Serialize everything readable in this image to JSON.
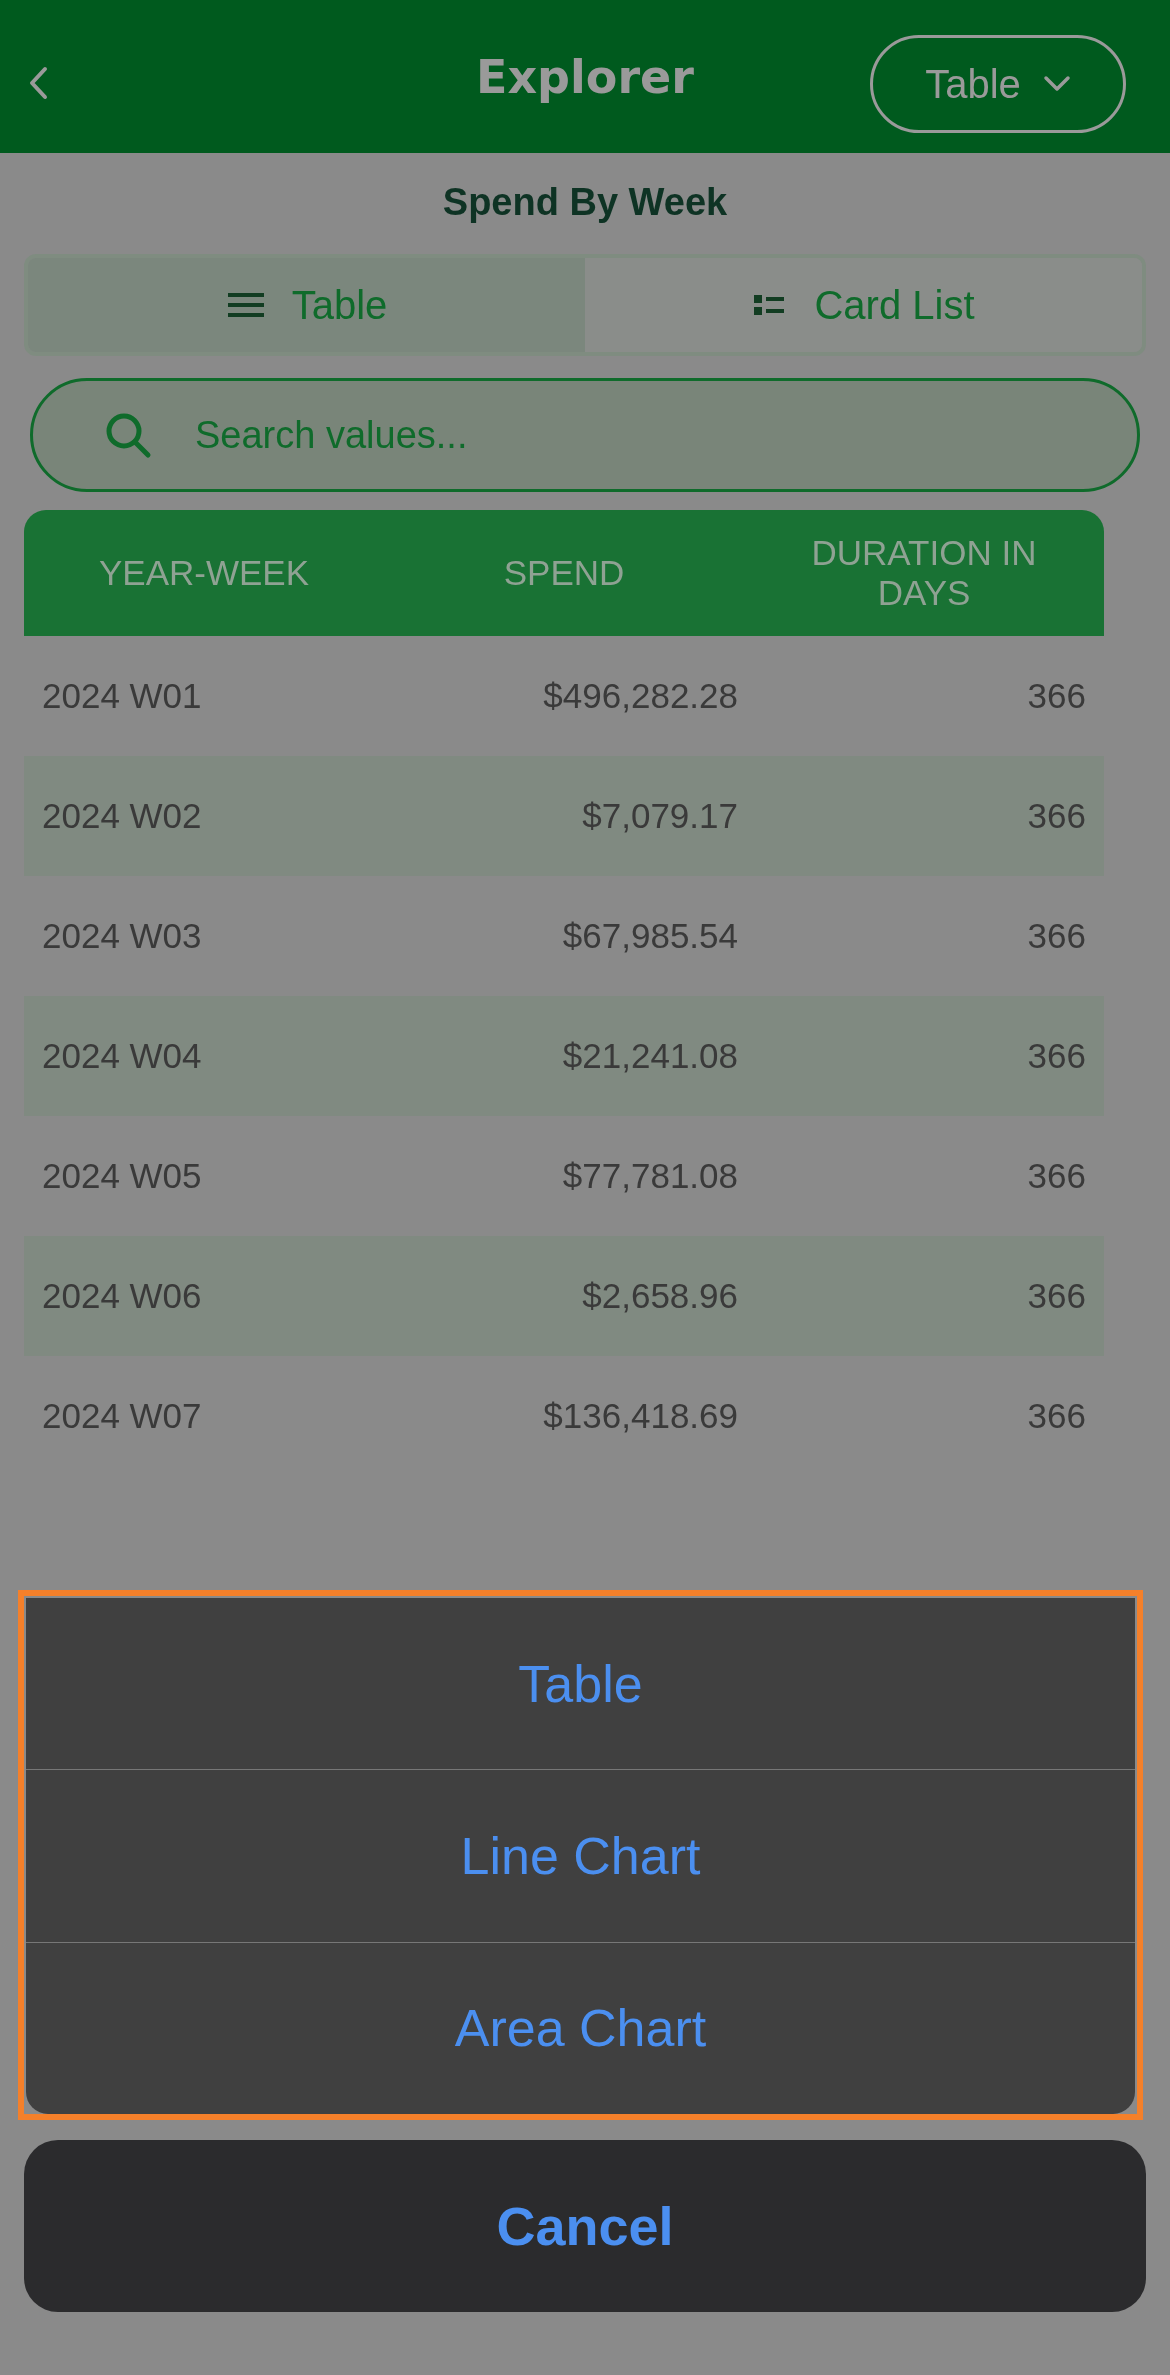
{
  "header": {
    "title": "Explorer",
    "view_menu": "Table"
  },
  "report_title": "Spend By Week",
  "view_tabs": [
    {
      "label": "Table",
      "kind": "table",
      "selected": true
    },
    {
      "label": "Card List",
      "kind": "cards",
      "selected": false
    }
  ],
  "search": {
    "placeholder": "Search values..."
  },
  "table": {
    "columns": [
      "YEAR-WEEK",
      "SPEND",
      "DURATION IN DAYS"
    ],
    "rows": [
      [
        "2024 W01",
        "$496,282.28",
        "366"
      ],
      [
        "2024 W02",
        "$7,079.17",
        "366"
      ],
      [
        "2024 W03",
        "$67,985.54",
        "366"
      ],
      [
        "2024 W04",
        "$21,241.08",
        "366"
      ],
      [
        "2024 W05",
        "$77,781.08",
        "366"
      ],
      [
        "2024 W06",
        "$2,658.96",
        "366"
      ],
      [
        "2024 W07",
        "$136,418.69",
        "366"
      ]
    ]
  },
  "action_sheet": {
    "options": [
      "Table",
      "Line Chart",
      "Area Chart"
    ],
    "cancel": "Cancel"
  }
}
